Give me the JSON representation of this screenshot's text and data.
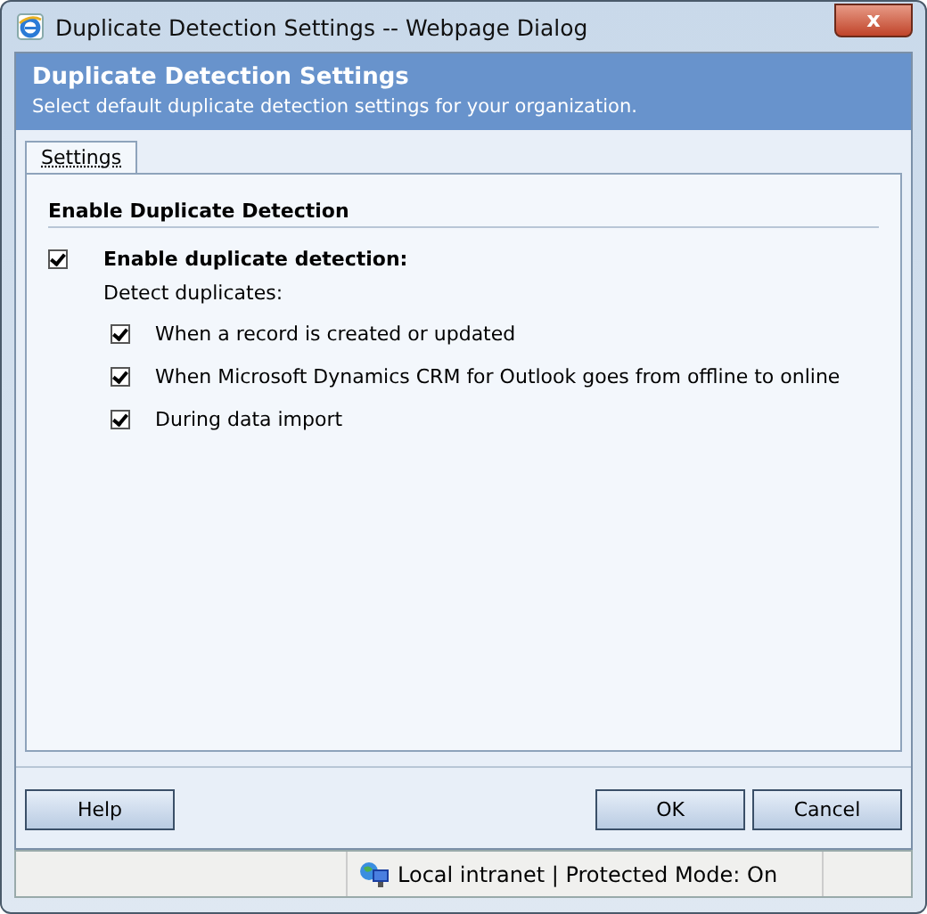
{
  "window": {
    "title": "Duplicate Detection Settings -- Webpage Dialog",
    "close": "x"
  },
  "header": {
    "title": "Duplicate Detection Settings",
    "subtitle": "Select default duplicate detection settings for your organization."
  },
  "tabs": [
    {
      "label": "Settings",
      "selected": true
    }
  ],
  "section": {
    "title": "Enable Duplicate Detection",
    "main_option": {
      "label": "Enable duplicate detection:",
      "checked": true
    },
    "sub_label": "Detect duplicates:",
    "options": [
      {
        "label": "When a record is created or updated",
        "checked": true
      },
      {
        "label": "When Microsoft Dynamics CRM for Outlook goes from offline to online",
        "checked": true
      },
      {
        "label": "During data import",
        "checked": true
      }
    ]
  },
  "buttons": {
    "left": [
      "Help"
    ],
    "right": [
      "OK",
      "Cancel"
    ]
  },
  "status_bar": {
    "zone": "Local intranet | Protected Mode: On"
  }
}
